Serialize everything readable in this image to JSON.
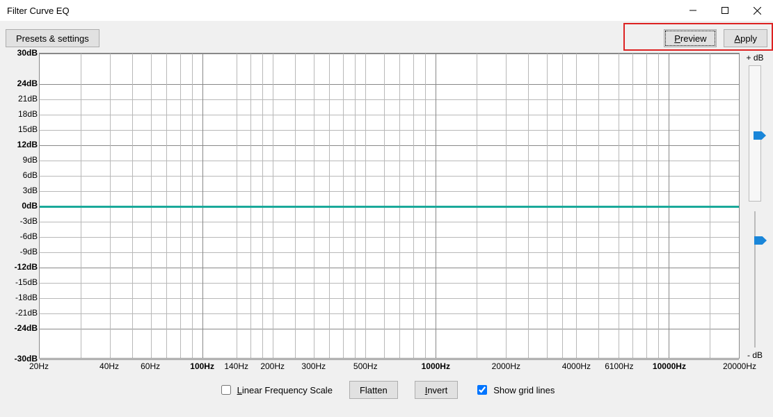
{
  "window": {
    "title": "Filter Curve EQ"
  },
  "toolbar": {
    "presets_label": "Presets & settings",
    "preview_label": "Preview",
    "apply_label": "Apply"
  },
  "sliders": {
    "plus_label": "+ dB",
    "minus_label": "- dB"
  },
  "bottom": {
    "linear_scale_label": "Linear Frequency Scale",
    "linear_scale_checked": false,
    "flatten_label": "Flatten",
    "invert_label": "Invert",
    "show_grid_label": "Show grid lines",
    "show_grid_checked": true
  },
  "chart_data": {
    "type": "line",
    "title": "Filter Curve EQ",
    "xscale": "log",
    "xlim": [
      20,
      20000
    ],
    "ylim": [
      -30,
      30
    ],
    "xticks": [
      {
        "v": 20,
        "label": "20Hz",
        "major": false
      },
      {
        "v": 40,
        "label": "40Hz",
        "major": false
      },
      {
        "v": 60,
        "label": "60Hz",
        "major": false
      },
      {
        "v": 100,
        "label": "100Hz",
        "major": true
      },
      {
        "v": 140,
        "label": "140Hz",
        "major": false
      },
      {
        "v": 200,
        "label": "200Hz",
        "major": false
      },
      {
        "v": 300,
        "label": "300Hz",
        "major": false
      },
      {
        "v": 500,
        "label": "500Hz",
        "major": false
      },
      {
        "v": 1000,
        "label": "1000Hz",
        "major": true
      },
      {
        "v": 2000,
        "label": "2000Hz",
        "major": false
      },
      {
        "v": 4000,
        "label": "4000Hz",
        "major": false
      },
      {
        "v": 6100,
        "label": "6100Hz",
        "major": false
      },
      {
        "v": 10000,
        "label": "10000Hz",
        "major": true
      },
      {
        "v": 20000,
        "label": "20000Hz",
        "major": false
      }
    ],
    "yticks": [
      {
        "v": 30,
        "label": "30dB",
        "major": true
      },
      {
        "v": 24,
        "label": "24dB",
        "major": true
      },
      {
        "v": 21,
        "label": "21dB",
        "major": false
      },
      {
        "v": 18,
        "label": "18dB",
        "major": false
      },
      {
        "v": 15,
        "label": "15dB",
        "major": false
      },
      {
        "v": 12,
        "label": "12dB",
        "major": true
      },
      {
        "v": 9,
        "label": "9dB",
        "major": false
      },
      {
        "v": 6,
        "label": "6dB",
        "major": false
      },
      {
        "v": 3,
        "label": "3dB",
        "major": false
      },
      {
        "v": 0,
        "label": "0dB",
        "major": true
      },
      {
        "v": -3,
        "label": "-3dB",
        "major": false
      },
      {
        "v": -6,
        "label": "-6dB",
        "major": false
      },
      {
        "v": -9,
        "label": "-9dB",
        "major": false
      },
      {
        "v": -12,
        "label": "-12dB",
        "major": true
      },
      {
        "v": -15,
        "label": "-15dB",
        "major": false
      },
      {
        "v": -18,
        "label": "-18dB",
        "major": false
      },
      {
        "v": -21,
        "label": "-21dB",
        "major": false
      },
      {
        "v": -24,
        "label": "-24dB",
        "major": true
      },
      {
        "v": -30,
        "label": "-30dB",
        "major": true
      }
    ],
    "grid_extra_x": [
      30,
      50,
      70,
      80,
      90,
      160,
      180,
      250,
      350,
      400,
      450,
      600,
      700,
      800,
      900,
      1500,
      2500,
      3000,
      3500,
      5000,
      7000,
      8000,
      9000,
      15000
    ],
    "series": [
      {
        "name": "curve",
        "x": [
          20,
          20000
        ],
        "y": [
          0,
          0
        ],
        "color": "#1aa99a"
      }
    ]
  }
}
